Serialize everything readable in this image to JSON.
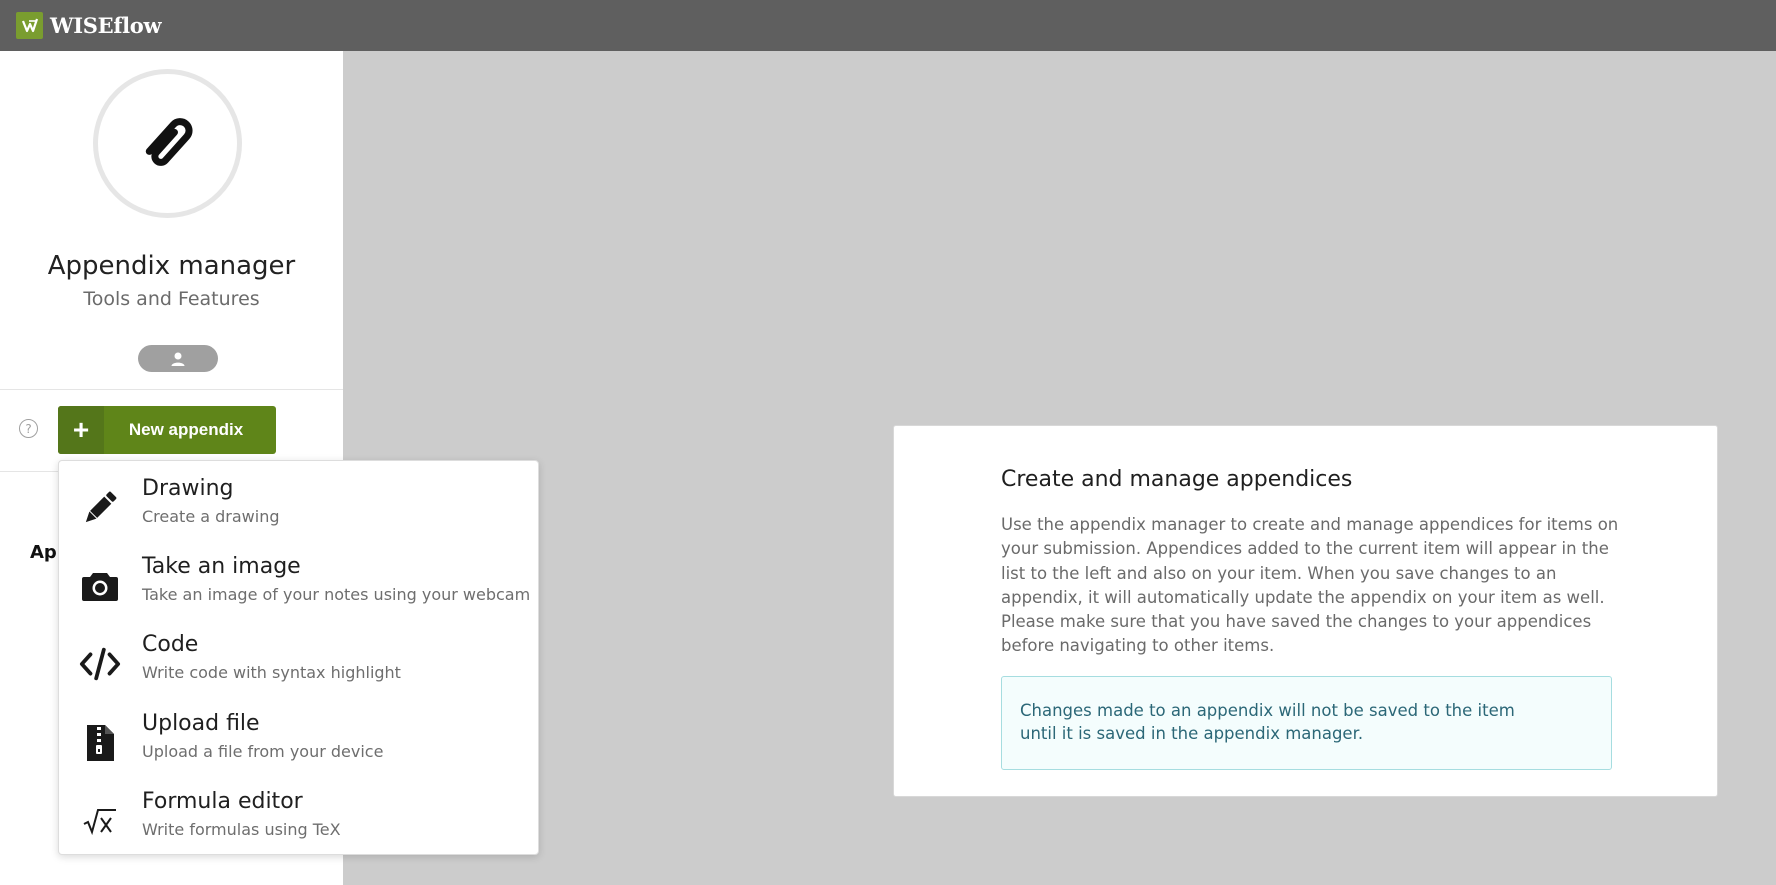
{
  "app": {
    "name": "WISEflow"
  },
  "sidebar": {
    "title": "Appendix manager",
    "subtitle": "Tools and Features",
    "new_appendix_label": "New appendix",
    "help_glyph": "?",
    "appendix_list_label_partial": "App"
  },
  "menu": {
    "items": [
      {
        "icon": "pencil-icon",
        "title": "Drawing",
        "desc": "Create a drawing"
      },
      {
        "icon": "camera-icon",
        "title": "Take an image",
        "desc": "Take an image of your notes using your webcam"
      },
      {
        "icon": "code-icon",
        "title": "Code",
        "desc": "Write code with syntax highlight"
      },
      {
        "icon": "zip-file-icon",
        "title": "Upload file",
        "desc": "Upload a file from your device"
      },
      {
        "icon": "sqrt-x-icon",
        "title": "Formula editor",
        "desc": "Write formulas using TeX"
      }
    ]
  },
  "main": {
    "heading": "Create and manage appendices",
    "body": "Use the appendix manager to create and manage appendices for items on your submission. Appendices added to the current item will appear in the list to the left and also on your item. When you save changes to an appendix, it will automatically update the appendix on your item as well. Please make sure that you have saved the changes to your appendices before navigating to other items.",
    "notice_line1": "Changes made to an appendix will not be saved to the item",
    "notice_line2": "until it is saved in the appendix manager."
  },
  "colors": {
    "topbar": "#5f5f5f",
    "logo": "#7a9d2f",
    "primary_button": "#5f8519",
    "notice_bg": "#f4fdfd",
    "notice_border": "#a6dde0",
    "notice_text": "#2b6777"
  }
}
